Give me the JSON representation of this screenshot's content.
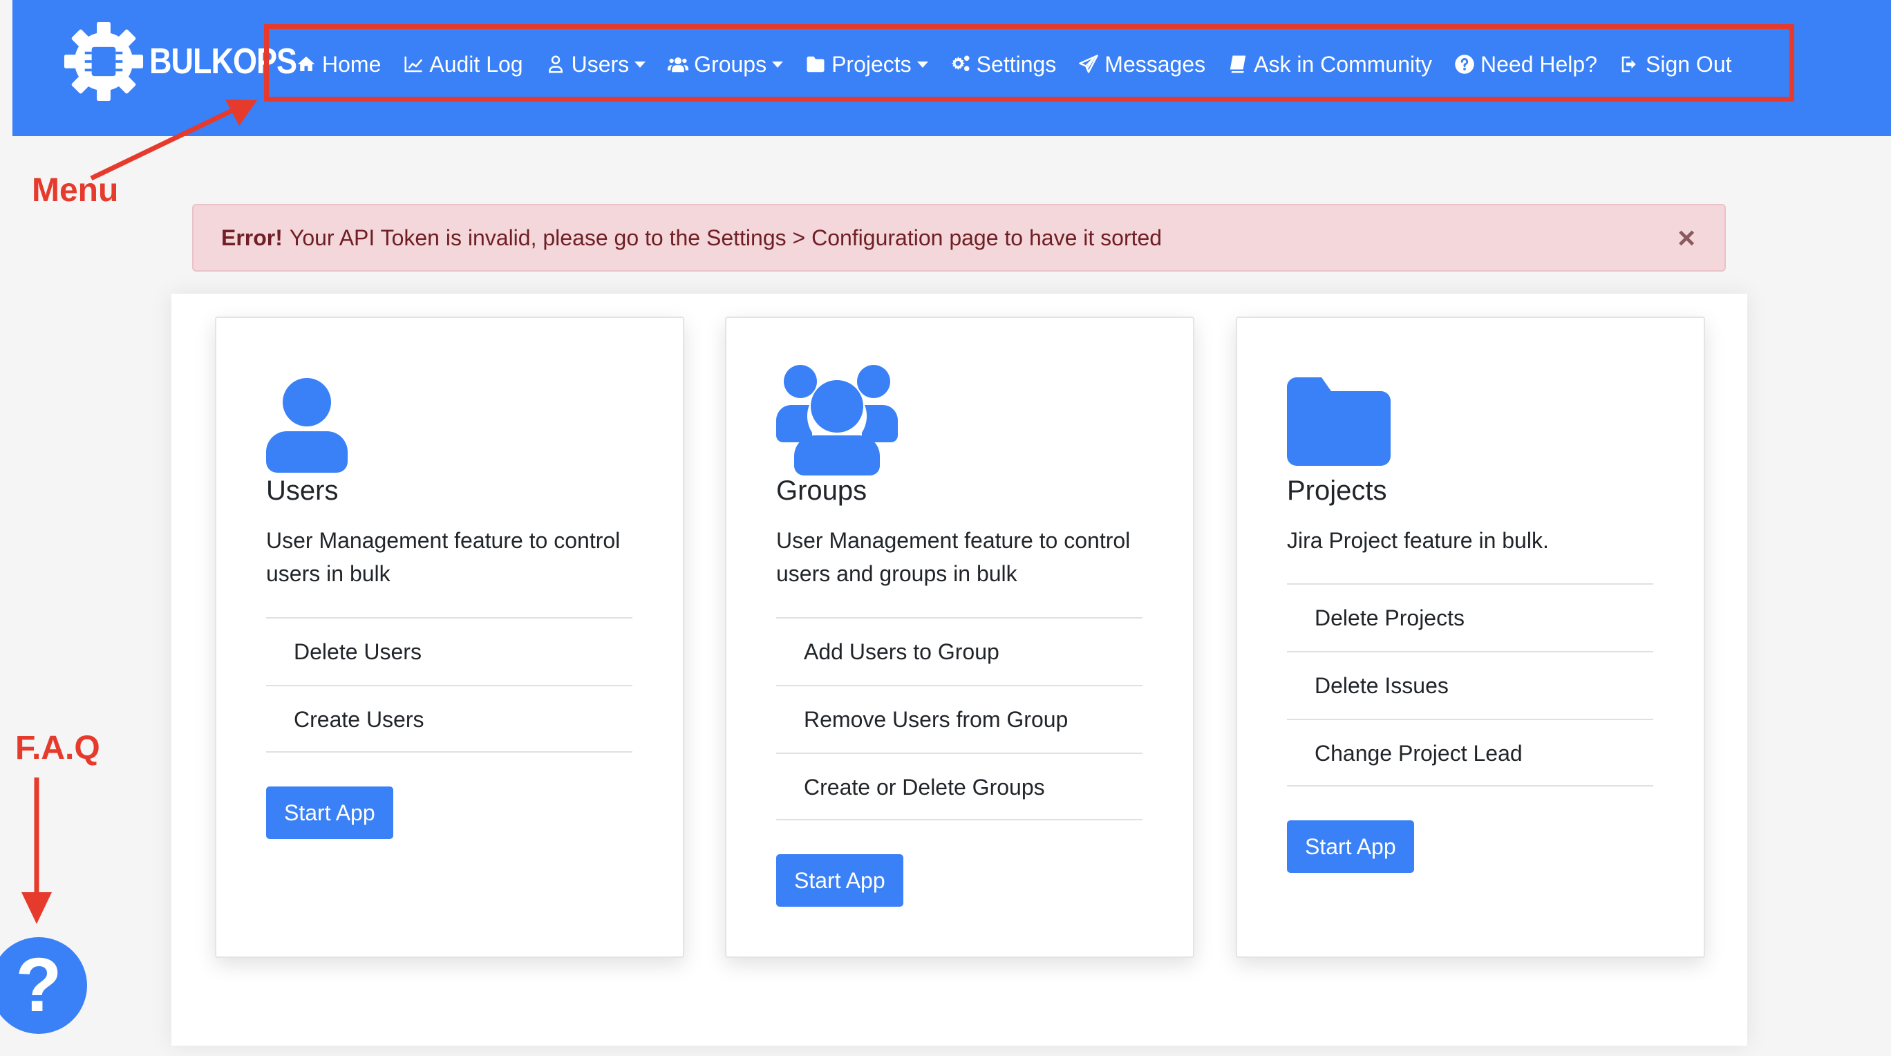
{
  "brand": {
    "name": "BULKOPS"
  },
  "menu": {
    "items": [
      {
        "label": "Home",
        "icon": "home-icon",
        "dropdown": false
      },
      {
        "label": "Audit Log",
        "icon": "line-chart-icon",
        "dropdown": false
      },
      {
        "label": "Users",
        "icon": "user-icon",
        "dropdown": true
      },
      {
        "label": "Groups",
        "icon": "users-icon",
        "dropdown": true
      },
      {
        "label": "Projects",
        "icon": "folder-icon",
        "dropdown": true
      },
      {
        "label": "Settings",
        "icon": "cogs-icon",
        "dropdown": false
      },
      {
        "label": "Messages",
        "icon": "paper-plane-icon",
        "dropdown": false
      },
      {
        "label": "Ask in Community",
        "icon": "book-icon",
        "dropdown": false
      },
      {
        "label": "Need Help?",
        "icon": "question-circle-icon",
        "dropdown": false
      },
      {
        "label": "Sign Out",
        "icon": "sign-out-icon",
        "dropdown": false
      }
    ]
  },
  "annotations": {
    "menu_label": "Menu",
    "faq_label": "F.A.Q"
  },
  "alert": {
    "title": "Error!",
    "message": "Your API Token is invalid, please go to the Settings > Configuration page to have it sorted",
    "close": "×"
  },
  "cards": [
    {
      "title": "Users",
      "description": "User Management feature to control users in bulk",
      "items": [
        "Delete Users",
        "Create Users"
      ],
      "button": "Start App"
    },
    {
      "title": "Groups",
      "description": "User Management feature to control users and groups in bulk",
      "items": [
        "Add Users to Group",
        "Remove Users from Group",
        "Create or Delete Groups"
      ],
      "button": "Start App"
    },
    {
      "title": "Projects",
      "description": "Jira Project feature in bulk.",
      "items": [
        "Delete Projects",
        "Delete Issues",
        "Change Project Lead"
      ],
      "button": "Start App"
    }
  ],
  "faq": {
    "symbol": "?"
  },
  "colors": {
    "primary": "#3a80f6",
    "annotation": "#e63a2c",
    "alert_bg": "#f3d7da"
  }
}
